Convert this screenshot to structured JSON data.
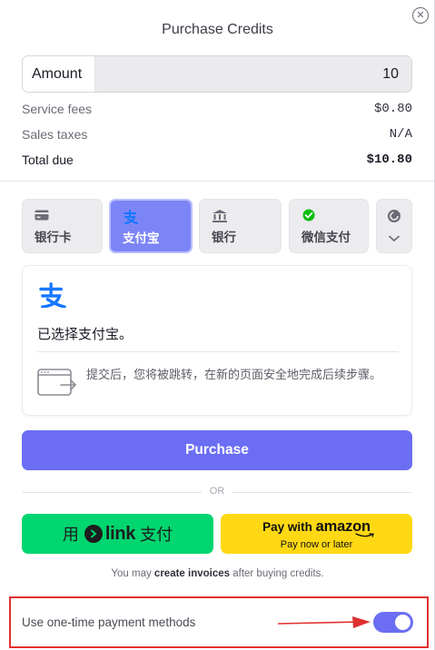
{
  "dialog": {
    "title": "Purchase Credits",
    "close_icon": "close-circle-icon"
  },
  "amount": {
    "label": "Amount",
    "value": "10"
  },
  "fees": {
    "service_label": "Service fees",
    "service_value": "$0.80",
    "tax_label": "Sales taxes",
    "tax_value": "N/A",
    "total_label": "Total due",
    "total_value": "$10.80"
  },
  "payment_tabs": [
    {
      "label": "银行卡",
      "icon": "card-icon",
      "active": false
    },
    {
      "label": "支付宝",
      "icon": "alipay-icon",
      "active": true
    },
    {
      "label": "银行",
      "icon": "bank-icon",
      "active": false
    },
    {
      "label": "微信支付",
      "icon": "wechat-pay-icon",
      "active": false
    }
  ],
  "more_tab_icons": [
    "coin-icon",
    "chevron-down-icon"
  ],
  "detail": {
    "icon": "alipay-icon",
    "selected_text": "已选择支付宝。",
    "note_icon": "redirect-window-icon",
    "note_text": "提交后，您将被跳转，在新的页面安全地完成后续步骤。"
  },
  "purchase_button": "Purchase",
  "or_text": "OR",
  "link_button": {
    "prefix": "用",
    "brand": "link",
    "suffix": "支付"
  },
  "amazon_button": {
    "line1_prefix": "Pay with",
    "line1_brand": "amazon",
    "line2": "Pay now or later"
  },
  "invoice_note": {
    "before": "You may ",
    "bold": "create invoices",
    "after": " after buying credits."
  },
  "one_time": {
    "label": "Use one-time payment methods",
    "enabled": true
  },
  "colors": {
    "accent": "#6b6ef3",
    "active_tab": "#7c85f5",
    "link_green": "#00d66f",
    "amazon_yellow": "#ffd814",
    "alipay_blue": "#1677ff",
    "wechat_green": "#09bb07",
    "annotation_red": "#e03131"
  }
}
